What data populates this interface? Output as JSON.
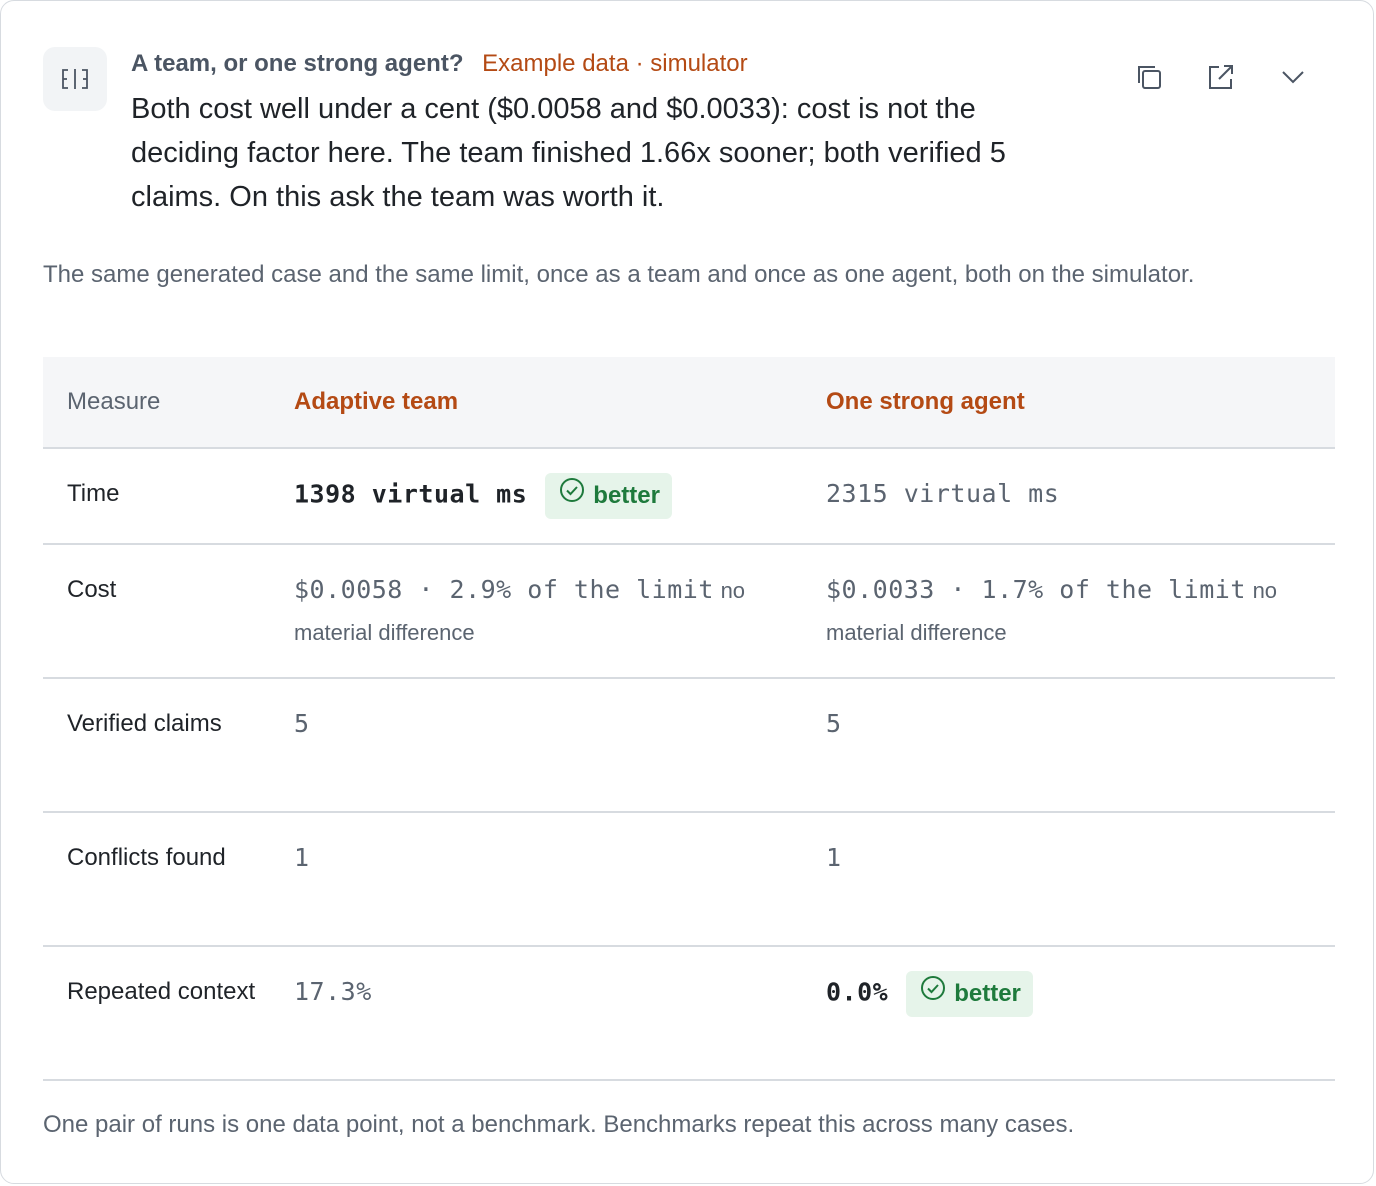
{
  "header": {
    "icon": "split-view-icon",
    "title": "A team, or one strong agent?",
    "tag": "Example data · simulator",
    "summary": "Both cost well under a cent ($0.0058 and $0.0033): cost is not the deciding factor here. The team finished 1.66x sooner; both verified 5 claims. On this ask the team was worth it."
  },
  "actions": [
    {
      "name": "copy-icon",
      "label": "copy"
    },
    {
      "name": "external-link-icon",
      "label": "open"
    },
    {
      "name": "chevron-down-icon",
      "label": "collapse"
    }
  ],
  "intro": "The same generated case and the same limit, once as a team and once as one agent, both on the simulator.",
  "table": {
    "headers": {
      "measure": "Measure",
      "team": "Adaptive team",
      "agent": "One strong agent"
    },
    "rows": [
      {
        "label": "Time",
        "team": "1398 virtual ms",
        "team_badge": "better",
        "agent": "2315 virtual ms",
        "agent_badge": ""
      },
      {
        "label": "Cost",
        "team": "$0.0058 · 2.9% of the limit",
        "team_note": "no material difference",
        "agent": "$0.0033 · 1.7% of the limit",
        "agent_note": "no material difference"
      },
      {
        "label": "Verified claims",
        "team": "5",
        "agent": "5"
      },
      {
        "label": "Conflicts found",
        "team": "1",
        "agent": "1"
      },
      {
        "label": "Repeated context",
        "team": "17.3%",
        "agent": "0.0%",
        "team_badge": "",
        "agent_badge": "better"
      }
    ]
  },
  "footnote": "One pair of runs is one data point, not a benchmark. Benchmarks repeat this across many cases.",
  "colors": {
    "accent": "#b44a14",
    "better_bg": "#e6f4ea",
    "better_fg": "#1e7a3c"
  }
}
